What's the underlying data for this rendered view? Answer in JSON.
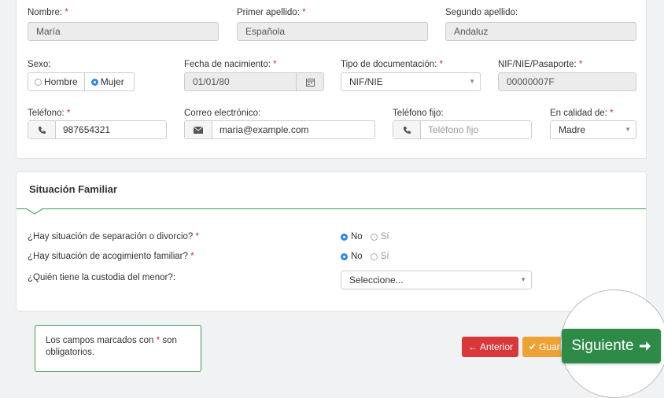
{
  "personal": {
    "nombre": {
      "label": "Nombre:",
      "value": "María"
    },
    "primer_apellido": {
      "label": "Primer apellido:",
      "value": "Española"
    },
    "segundo_apellido": {
      "label": "Segundo apellido:",
      "value": "Andaluz"
    },
    "sexo": {
      "label": "Sexo:",
      "options": [
        "Hombre",
        "Mujer"
      ],
      "selected": "Mujer"
    },
    "fecha_nacimiento": {
      "label": "Fecha de nacimiento:",
      "value": "01/01/80",
      "icon": "calendar-icon"
    },
    "tipo_documentacion": {
      "label": "Tipo de documentación:",
      "value": "NIF/NIE"
    },
    "nif": {
      "label": "NIF/NIE/Pasaporte:",
      "value": "00000007F"
    },
    "telefono": {
      "label": "Teléfono:",
      "value": "987654321",
      "icon": "phone-icon"
    },
    "correo": {
      "label": "Correo electrónico:",
      "value": "maria@example.com",
      "icon": "envelope-icon"
    },
    "telefono_fijo": {
      "label": "Teléfono fijo:",
      "placeholder": "Teléfono fijo",
      "icon": "phone-icon"
    },
    "calidad": {
      "label": "En calidad de:",
      "value": "Madre"
    }
  },
  "familia": {
    "title": "Situación Familiar",
    "q1": {
      "text": "¿Hay situación de separación o divorcio?",
      "yes": "Sí",
      "no": "No",
      "selected": "No"
    },
    "q2": {
      "text": "¿Hay situación de acogimiento familiar?",
      "yes": "Sí",
      "no": "No",
      "selected": "No"
    },
    "q3": {
      "text": "¿Quién tiene la custodia del menor?:",
      "value": "Seleccione..."
    }
  },
  "footer": {
    "note_text": "Los campos marcados con",
    "note_star": "*",
    "note_text2": "son obligatorios.",
    "prev_label": "Anterior",
    "save_label": "Guar",
    "next_label": "Siguiente"
  },
  "required_mark": "*",
  "colors": {
    "accent_green": "#2e8b47",
    "radio_blue": "#2b8ae6",
    "danger": "#d9383a",
    "warning": "#eea236"
  }
}
